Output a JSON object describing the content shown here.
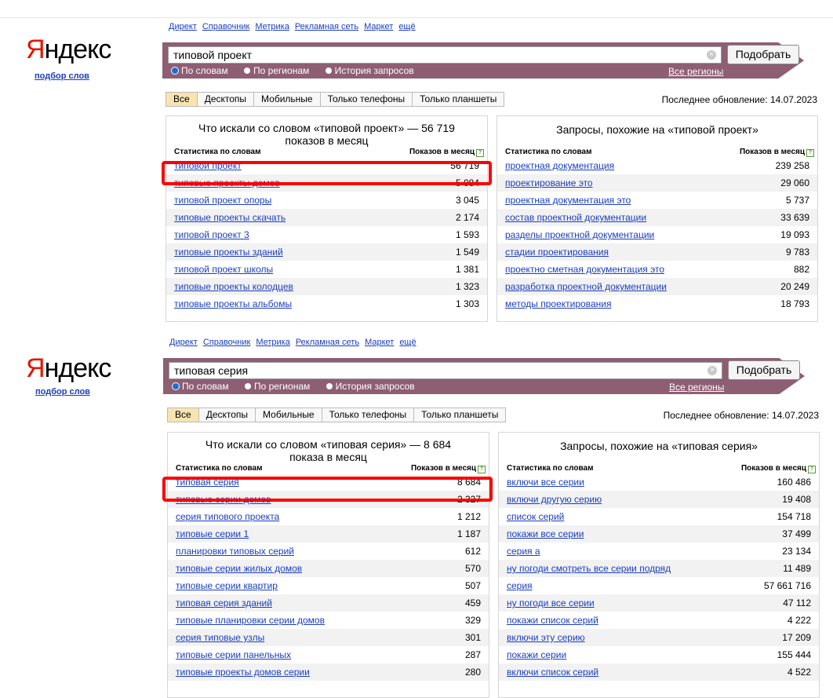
{
  "logo": {
    "first": "Я",
    "rest": "ндекс",
    "subtitle": "подбор слов"
  },
  "services": [
    "Директ",
    "Справочник",
    "Метрика",
    "Рекламная сеть",
    "Маркет",
    "ещё"
  ],
  "button_label": "Подобрать",
  "radios": [
    "По словам",
    "По регионам",
    "История запросов"
  ],
  "regions_link": "Все регионы",
  "tabs": [
    "Все",
    "Десктопы",
    "Мобильные",
    "Только телефоны",
    "Только планшеты"
  ],
  "updated": "Последнее обновление: 14.07.2023",
  "col_words": "Статистика по словам",
  "col_shows": "Показов в месяц",
  "panels": [
    {
      "query": "типовой проект",
      "left_title": "Что искали со словом «типовой проект» — 56 719 показов в месяц",
      "right_title": "Запросы, похожие на «типовой проект»",
      "left_rows": [
        {
          "kw": "типовой проект",
          "n": "56 719"
        },
        {
          "kw": "типовые проекты домов",
          "n": "5 084"
        },
        {
          "kw": "типовой проект опоры",
          "n": "3 045"
        },
        {
          "kw": "типовые проекты скачать",
          "n": "2 174"
        },
        {
          "kw": "типовой проект 3",
          "n": "1 593"
        },
        {
          "kw": "типовые проекты зданий",
          "n": "1 549"
        },
        {
          "kw": "типовой проект школы",
          "n": "1 381"
        },
        {
          "kw": "типовые проекты колодцев",
          "n": "1 323"
        },
        {
          "kw": "типовые проекты альбомы",
          "n": "1 303"
        }
      ],
      "right_rows": [
        {
          "kw": "проектная документация",
          "n": "239 258"
        },
        {
          "kw": "проектирование это",
          "n": "29 060"
        },
        {
          "kw": "проектная документация это",
          "n": "5 737"
        },
        {
          "kw": "состав проектной документации",
          "n": "33 639"
        },
        {
          "kw": "разделы проектной документации",
          "n": "19 093"
        },
        {
          "kw": "стадии проектирования",
          "n": "9 783"
        },
        {
          "kw": "проектно сметная документация это",
          "n": "882"
        },
        {
          "kw": "разработка проектной документации",
          "n": "20 249"
        },
        {
          "kw": "методы проектирования",
          "n": "18 793"
        }
      ]
    },
    {
      "query": "типовая серия",
      "left_title": "Что искали со словом «типовая серия» — 8 684 показа в месяц",
      "right_title": "Запросы, похожие на «типовая серия»",
      "left_rows": [
        {
          "kw": "типовая серия",
          "n": "8 684"
        },
        {
          "kw": "типовые серии домов",
          "n": "2 327"
        },
        {
          "kw": "серия типового проекта",
          "n": "1 212"
        },
        {
          "kw": "типовые серии 1",
          "n": "1 187"
        },
        {
          "kw": "планировки типовых серий",
          "n": "612"
        },
        {
          "kw": "типовые серии жилых домов",
          "n": "570"
        },
        {
          "kw": "типовые серии квартир",
          "n": "507"
        },
        {
          "kw": "типовая серия зданий",
          "n": "459"
        },
        {
          "kw": "типовые планировки серии домов",
          "n": "329"
        },
        {
          "kw": "серия типовые узлы",
          "n": "301"
        },
        {
          "kw": "типовые серии панельных",
          "n": "287"
        },
        {
          "kw": "типовые проекты домов серии",
          "n": "280"
        }
      ],
      "right_rows": [
        {
          "kw": "включи все серии",
          "n": "160 486"
        },
        {
          "kw": "включи другую серию",
          "n": "19 408"
        },
        {
          "kw": "список серий",
          "n": "154 718"
        },
        {
          "kw": "покажи все серии",
          "n": "37 499"
        },
        {
          "kw": "серия а",
          "n": "23 134"
        },
        {
          "kw": "ну погоди смотреть все серии подряд",
          "n": "11 489"
        },
        {
          "kw": "серия",
          "n": "57 661 716"
        },
        {
          "kw": "ну погоди все серии",
          "n": "47 112"
        },
        {
          "kw": "покажи список серий",
          "n": "4 222"
        },
        {
          "kw": "включи эту серию",
          "n": "17 209"
        },
        {
          "kw": "покажи серии",
          "n": "155 444"
        },
        {
          "kw": "включи список серий",
          "n": "4 522"
        }
      ]
    }
  ]
}
